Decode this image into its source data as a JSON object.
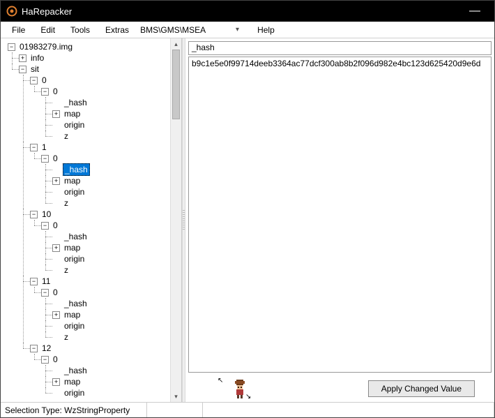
{
  "app": {
    "title": "HaRepacker"
  },
  "menu": {
    "file": "File",
    "edit": "Edit",
    "tools": "Tools",
    "extras": "Extras",
    "combo_value": "BMS\\GMS\\MSEA",
    "help": "Help"
  },
  "tree": {
    "root": "01983279.img",
    "info": "info",
    "sit": "sit",
    "n0": "0",
    "n1": "1",
    "n10": "10",
    "n11": "11",
    "n12": "12",
    "child0": "0",
    "hash": "_hash",
    "map": "map",
    "origin": "origin",
    "z": "z"
  },
  "detail": {
    "field_name": "_hash",
    "field_value": "b9c1e5e0f99714deeb3364ac77dcf300ab8b2f096d982e4bc123d625420d9e6d"
  },
  "buttons": {
    "apply": "Apply Changed Value"
  },
  "status": {
    "selection_type": "Selection Type: WzStringProperty"
  },
  "icons": {
    "minimize": "—"
  }
}
